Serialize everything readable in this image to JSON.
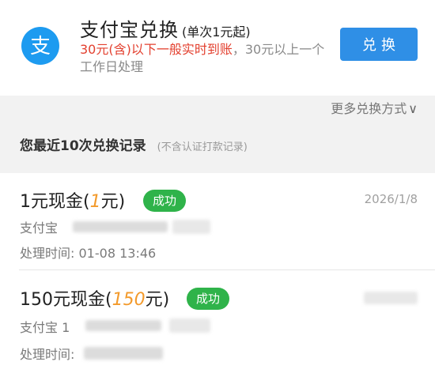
{
  "header": {
    "title": "支付宝兑换",
    "subtitle": "(单次1元起)",
    "desc_red": "30元(含)以下一般实时到账",
    "desc_gray": "，30元以上一个工作日处理",
    "exchange_label": "兑换",
    "logo_glyph": "支",
    "logo_icon": "alipay-icon",
    "accent_color": "#2f8fe6"
  },
  "more_ways": {
    "label": "更多兑换方式",
    "chevron": "∨"
  },
  "records": {
    "heading": "您最近10次兑换记录",
    "note": "(不含认证打款记录)",
    "items": [
      {
        "amount_prefix": "1元现金(",
        "amount_value": "1",
        "amount_suffix": "元)",
        "status": "成功",
        "date": "2026/1/8",
        "channel": "支付宝",
        "account_visible": "",
        "time_label": "处理时间:",
        "time_value": "01-08 13:46"
      },
      {
        "amount_prefix": "150元现金(",
        "amount_value": "150",
        "amount_suffix": "元)",
        "status": "成功",
        "date": "",
        "channel": "支付宝",
        "account_visible": "1",
        "time_label": "处理时间:",
        "time_value": ""
      }
    ]
  },
  "colors": {
    "success_green": "#2fb34a",
    "red_text": "#e3402f",
    "orange_value": "#f39a2b"
  }
}
